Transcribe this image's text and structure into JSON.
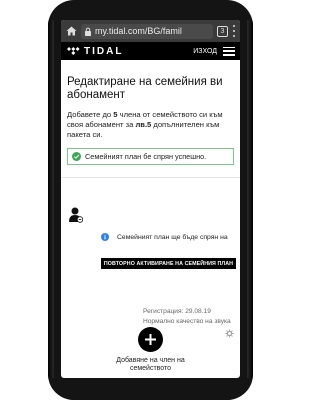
{
  "browser": {
    "url": "my.tidal.com/BG/famil",
    "tab_count": "3"
  },
  "header": {
    "brand": "TIDAL",
    "logout_label": "ИЗХОД"
  },
  "page": {
    "title": "Редактиране на семейния ви абонамент",
    "intro_1": "Добавете до ",
    "intro_count": "5",
    "intro_2": " члена от семейството си към своя абонамент за ",
    "intro_price": "лв.5",
    "intro_3": " допълнителен към пакета си."
  },
  "alert": {
    "text": "Семейният план бе спрян  успешно."
  },
  "member_card": {
    "info_text": "Семейният план ще бъде спрян на",
    "reactivate_label": "ПОВТОРНО АКТИВИРАНЕ НА СЕМЕЙНИЯ ПЛАН",
    "registration": "Регистрация: 29.08.19",
    "quality": "Нормално качество на звука"
  },
  "add_member": {
    "label_line1": "Добавяне на член на",
    "label_line2": "семейството"
  },
  "colors": {
    "accent_black": "#000000",
    "success_border": "#7bc68c",
    "info_blue": "#2f80ed"
  }
}
